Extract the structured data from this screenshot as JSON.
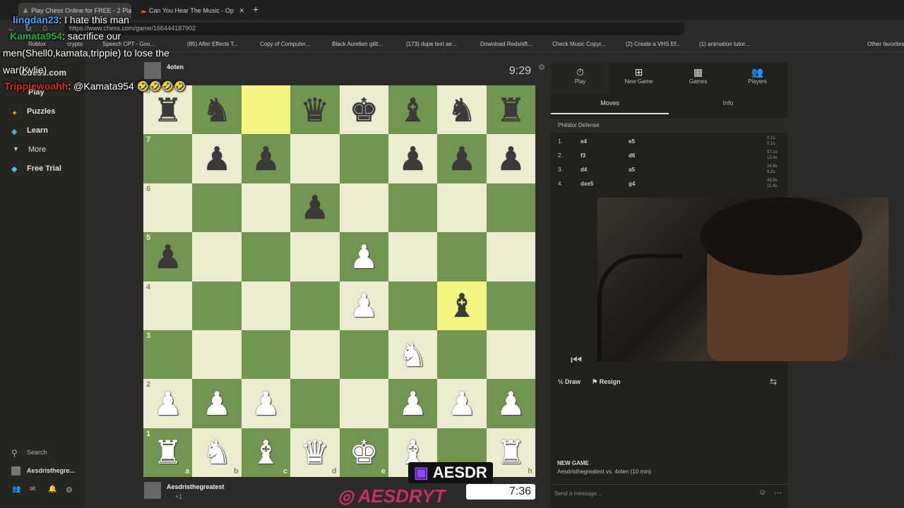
{
  "browser": {
    "tabs": [
      "Play Chess Online for FREE - 2 Pla",
      "Can You Hear The Music - Op"
    ],
    "url": "https://www.chess.com/game/166444187902",
    "bookmarks": [
      "Roblox",
      "crypto",
      "Speech CPT - Goo...",
      "(85) After Effects T...",
      "Copy of Computer...",
      "Black Aurelien glitt...",
      "(173) dupe text ae...",
      "Download Redshift...",
      "Check Music Copyr...",
      "(2) Create a VHS Ef...",
      "(1) animation tutor..."
    ],
    "other_favorites": "Other favorites"
  },
  "sidebar": {
    "logo": "Chess.com",
    "items": [
      "Play",
      "Puzzles",
      "Learn",
      "More",
      "Free Trial"
    ],
    "search": "Search",
    "user": "Aesdristhegre..."
  },
  "game": {
    "top_player": "4oten",
    "top_clock": "9:29",
    "bottom_player": "Aesdristhegreatest",
    "bottom_rating": "+1",
    "bottom_clock": "7:36",
    "ranks": [
      "8",
      "7",
      "6",
      "5",
      "4",
      "3",
      "2",
      "1"
    ],
    "files": [
      "a",
      "b",
      "c",
      "d",
      "e",
      "f",
      "g",
      "h"
    ],
    "board": [
      [
        "r",
        "n",
        "",
        "q",
        "k",
        "b",
        "n",
        "r"
      ],
      [
        "",
        "p",
        "p",
        "",
        "",
        "p",
        "p",
        "p"
      ],
      [
        "",
        "",
        "",
        "p",
        "",
        "",
        "",
        ""
      ],
      [
        "p",
        "",
        "",
        "",
        "P",
        "",
        "",
        ""
      ],
      [
        "",
        "",
        "",
        "",
        "P",
        "",
        "b",
        ""
      ],
      [
        "",
        "",
        "",
        "",
        "",
        "N",
        "",
        ""
      ],
      [
        "P",
        "P",
        "P",
        "",
        "",
        "P",
        "P",
        "P"
      ],
      [
        "R",
        "N",
        "B",
        "Q",
        "K",
        "B",
        "",
        "R"
      ]
    ]
  },
  "panel": {
    "tabs": [
      "Play",
      "New Game",
      "Games",
      "Players"
    ],
    "subtabs": [
      "Moves",
      "Info"
    ],
    "opening": "Philidor Defense",
    "moves": [
      {
        "n": "1.",
        "w": "e4",
        "b": "e5",
        "t1": "0.1s",
        "t2": "0.1s"
      },
      {
        "n": "2.",
        "w": "f3",
        "b": "d6",
        "t1": "57.1s",
        "t2": "12.4s"
      },
      {
        "n": "3.",
        "w": "d4",
        "b": "a5",
        "t1": "24.8s",
        "t2": "6.2s"
      },
      {
        "n": "4.",
        "w": "dxe5",
        "b": "g4",
        "t1": "43.6s",
        "t2": "11.4s"
      }
    ],
    "draw": "Draw",
    "resign": "Resign",
    "new_game_title": "NEW GAME",
    "new_game_desc": "Aesdristhegreatest vs. 4oten (10 min)",
    "message_placeholder": "Send a message..."
  },
  "chat": [
    {
      "user": "lingdan23",
      "text": ": I hate this man",
      "color": "#4aa3ff"
    },
    {
      "user": "Kamata954",
      "text": ": sacrifice our",
      "color": "#1fb33a"
    },
    {
      "user": "",
      "text": "men(Shell0,kamata,trippie) to lose the",
      "color": "#ffffff"
    },
    {
      "user": "",
      "text": "war(Kylie)",
      "color": "#ffffff"
    },
    {
      "user": "Trippiewoahh",
      "text": ": @Kamata954 🤣🤣🤣🤣",
      "color": "#d42a2a"
    }
  ],
  "watermark": {
    "twitch": "AESDR",
    "instagram": "AESDRYT"
  }
}
